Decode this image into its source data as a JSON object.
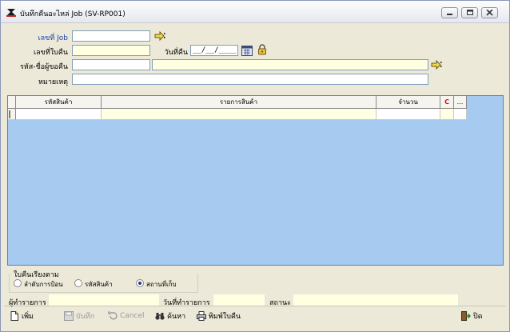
{
  "window": {
    "title": "บันทึกคืนอะไหล่ Job (SV-RP001)"
  },
  "form": {
    "job_label": "เลขที่ Job",
    "return_no_label": "เลขที่ใบคืน",
    "return_date_label": "วันที่คืน",
    "return_date_value": "__/__/____",
    "returner_label": "รหัส-ชื่อผู้ขอคืน",
    "remark_label": "หมายเหตุ"
  },
  "table": {
    "columns": [
      "รหัสสินค้า",
      "รายการสินค้า",
      "จำนวน",
      "C",
      "..."
    ]
  },
  "sort": {
    "label": "ใบคืนเรียงตาม",
    "options": [
      "ลำดับการป้อน",
      "รหัสสินค้า",
      "สถานที่เก็บ"
    ],
    "selected": "สถานที่เก็บ"
  },
  "status": {
    "user_label": "ผู้ทำรายการ",
    "date_label": "วันที่ทำรายการ",
    "state_label": "สถานะ"
  },
  "toolbar": {
    "add": "เพิ่ม",
    "save": "บันทึก",
    "cancel": "Cancel",
    "search": "ค้นหา",
    "print": "พิมพ์ใบคืน",
    "close": "ปิด"
  },
  "colors": {
    "accent_blue": "#1f3fb0",
    "grid_bg": "#a6caf0",
    "yellow_field": "#ffffe1"
  }
}
